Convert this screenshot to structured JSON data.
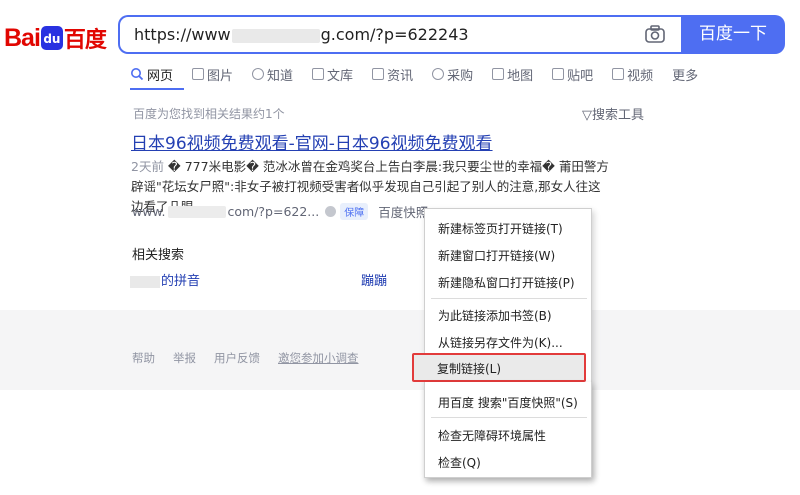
{
  "logo": {
    "bai": "Bai",
    "paw": "du",
    "cn": "百度"
  },
  "search": {
    "url_prefix": "https://www",
    "url_suffix": "g.com/?p=622243",
    "button_label": "百度一下",
    "camera_icon": "camera-icon"
  },
  "tabs": [
    {
      "label": "网页",
      "icon": "search-icon"
    },
    {
      "label": "图片",
      "icon": "image-icon"
    },
    {
      "label": "知道",
      "icon": "question-icon"
    },
    {
      "label": "文库",
      "icon": "document-icon"
    },
    {
      "label": "资讯",
      "icon": "news-icon"
    },
    {
      "label": "采购",
      "icon": "purchase-icon"
    },
    {
      "label": "地图",
      "icon": "map-icon"
    },
    {
      "label": "贴吧",
      "icon": "tieba-icon"
    },
    {
      "label": "视频",
      "icon": "video-icon"
    },
    {
      "label": "更多",
      "icon": ""
    }
  ],
  "results": {
    "count_text": "百度为您找到相关结果约1个",
    "tools_label": "搜索工具",
    "title": "日本96视频免费观看-官网-日本96视频免费观看",
    "date": "2天前",
    "desc": " � 777米电影� 范冰冰曾在金鸡奖台上告白李晨:我只要尘世的幸福� 莆田警方辟谣\"花坛女尸照\":非女子被打视频受害者似乎发现自己引起了别人的注意,那女人往这边看了几眼...",
    "url_prefix": "www.",
    "url_suffix": "com/?p=622...",
    "badge": "保障",
    "snapshot": "百度快照"
  },
  "related": {
    "title": "相关搜索",
    "item1": "的拼音",
    "item2": "蹦蹦"
  },
  "footer": {
    "help": "帮助",
    "report": "举报",
    "feedback": "用户反馈",
    "survey": "邀您参加小调查"
  },
  "context_menu": {
    "items": [
      "新建标签页打开链接(T)",
      "新建窗口打开链接(W)",
      "新建隐私窗口打开链接(P)",
      "为此链接添加书签(B)",
      "从链接另存文件为(K)...",
      "复制链接(L)",
      "用百度 搜索\"百度快照\"(S)",
      "检查无障碍环境属性",
      "检查(Q)"
    ],
    "highlighted_index": 5,
    "highlight_color": "#e23b3b"
  },
  "colors": {
    "accent": "#4e6ef2",
    "link": "#2440b3",
    "logo_red": "#e10601",
    "logo_blue": "#2932e1"
  }
}
